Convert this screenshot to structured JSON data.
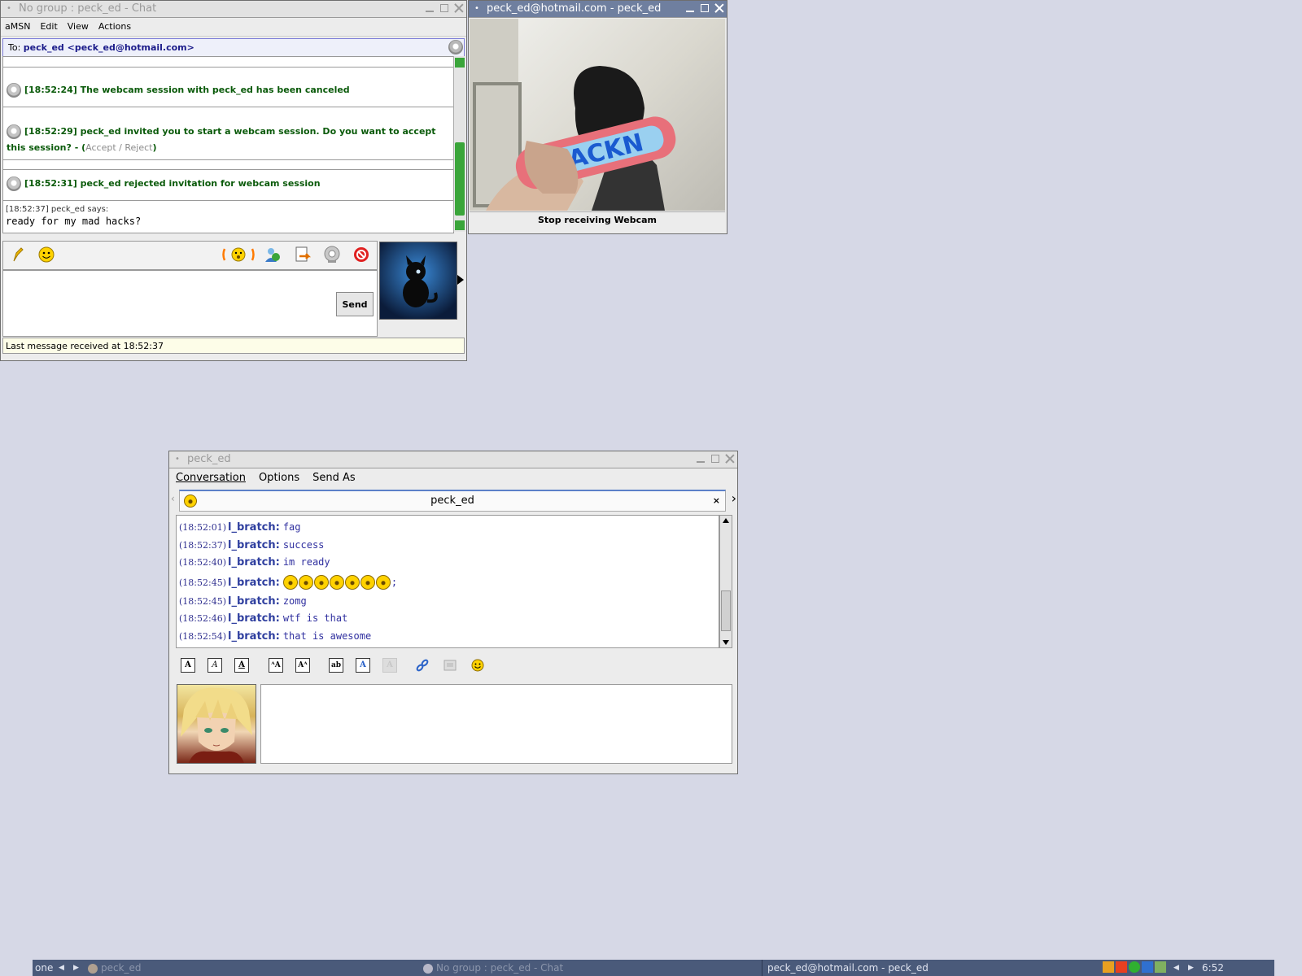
{
  "amsn_chat": {
    "title": "No group : peck_ed - Chat",
    "menu": [
      "aMSN",
      "Edit",
      "View",
      "Actions"
    ],
    "to_label": "To:",
    "to_address": "peck_ed <peck_ed@hotmail.com>",
    "messages": [
      {
        "text": "[18:52:24] The webcam session with peck_ed has been canceled"
      },
      {
        "text_before": "[18:52:29] peck_ed invited you to start a webcam session. Do you want to accept this session? - (",
        "accept": "Accept",
        "slash": " / ",
        "reject": "Reject",
        "text_after": ")"
      },
      {
        "text": "[18:52:31] peck_ed rejected invitation for webcam session"
      }
    ],
    "last_says": "[18:52:37] peck_ed says:",
    "last_text": "ready for my mad hacks?",
    "send_label": "Send",
    "status": "Last message received at 18:52:37"
  },
  "webcam_window": {
    "title": "peck_ed@hotmail.com - peck_ed",
    "banner_text": "HACKN",
    "stop_label": "Stop receiving Webcam"
  },
  "pidgin": {
    "title": "peck_ed",
    "menu": [
      "Conversation",
      "Options",
      "Send As"
    ],
    "tab_label": "peck_ed",
    "log": [
      {
        "ts": "(18:52:01)",
        "nick": "l_bratch:",
        "text": "fag"
      },
      {
        "ts": "(18:52:37)",
        "nick": "l_bratch:",
        "text": "success"
      },
      {
        "ts": "(18:52:40)",
        "nick": "l_bratch:",
        "text": "im ready"
      },
      {
        "ts": "(18:52:45)",
        "nick": "l_bratch:",
        "text": ";"
      },
      {
        "ts": "(18:52:45)",
        "nick": "l_bratch:",
        "text": "zomg"
      },
      {
        "ts": "(18:52:46)",
        "nick": "l_bratch:",
        "text": "wtf is that"
      },
      {
        "ts": "(18:52:54)",
        "nick": "l_bratch:",
        "text": "that is awesome"
      }
    ],
    "smiley_count": 7
  },
  "taskbar": {
    "desktop": "one",
    "task1": "peck_ed",
    "task2": "No group : peck_ed - Chat",
    "task3": "peck_ed@hotmail.com - peck_ed",
    "clock": "6:52"
  },
  "colors": {
    "desktop": "#d6d8e6",
    "active_title": "#6f7f9f",
    "system_message": "#0a5a0a",
    "chat_nick": "#2f3f9f",
    "taskbar": "#4a5a7a"
  }
}
